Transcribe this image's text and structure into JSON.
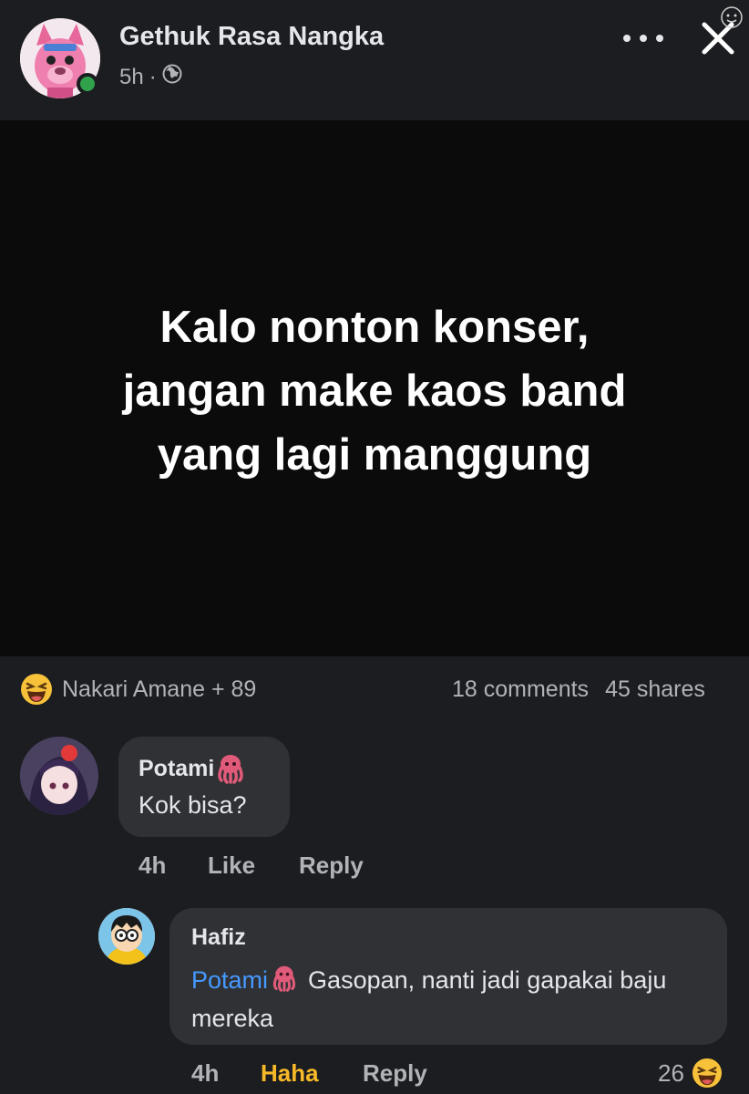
{
  "header": {
    "author": "Gethuk Rasa Nangka",
    "time": "5h",
    "dot": "·",
    "privacy_icon": "globe-icon"
  },
  "post": {
    "lines": [
      "Kalo nonton konser,",
      "jangan make kaos band",
      "yang lagi manggung"
    ]
  },
  "reactions": {
    "icon": "haha-emoji-icon",
    "summary": "Nakari Amane + 89",
    "comments": "18 comments",
    "shares": "45 shares"
  },
  "comments": [
    {
      "author": "Potami",
      "text": "Kok bisa?",
      "time": "4h",
      "like": "Like",
      "reply": "Reply"
    },
    {
      "author": "Hafiz",
      "mention": "Potami",
      "text": "Gasopan, nanti jadi gapakai baju mereka",
      "time": "4h",
      "reaction_label": "Haha",
      "reply": "Reply",
      "reaction_count": "26"
    }
  ],
  "colors": {
    "background": "#1c1d20",
    "bubble": "#303134",
    "mention": "#4599ff",
    "haha": "#f7b928",
    "online": "#31a24c"
  }
}
